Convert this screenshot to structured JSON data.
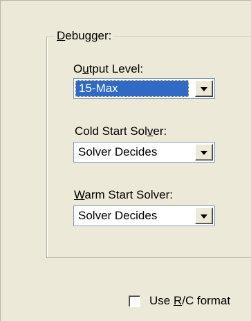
{
  "debugger_group": {
    "title_mnemonic": "D",
    "title_rest": "ebugger:"
  },
  "output_level": {
    "label_pre": "O",
    "label_mnemonic": "u",
    "label_post": "tput Level:",
    "value": "15-Max"
  },
  "cold_start": {
    "label_pre": "Cold Start Sol",
    "label_mnemonic": "v",
    "label_post": "er:",
    "value": "Solver Decides"
  },
  "warm_start": {
    "label_pre": "",
    "label_mnemonic": "W",
    "label_post": "arm Start Solver:",
    "value": "Solver Decides"
  },
  "rc_format": {
    "label_pre": "Use ",
    "label_mnemonic": "R",
    "label_post": "/C format",
    "checked": false
  }
}
